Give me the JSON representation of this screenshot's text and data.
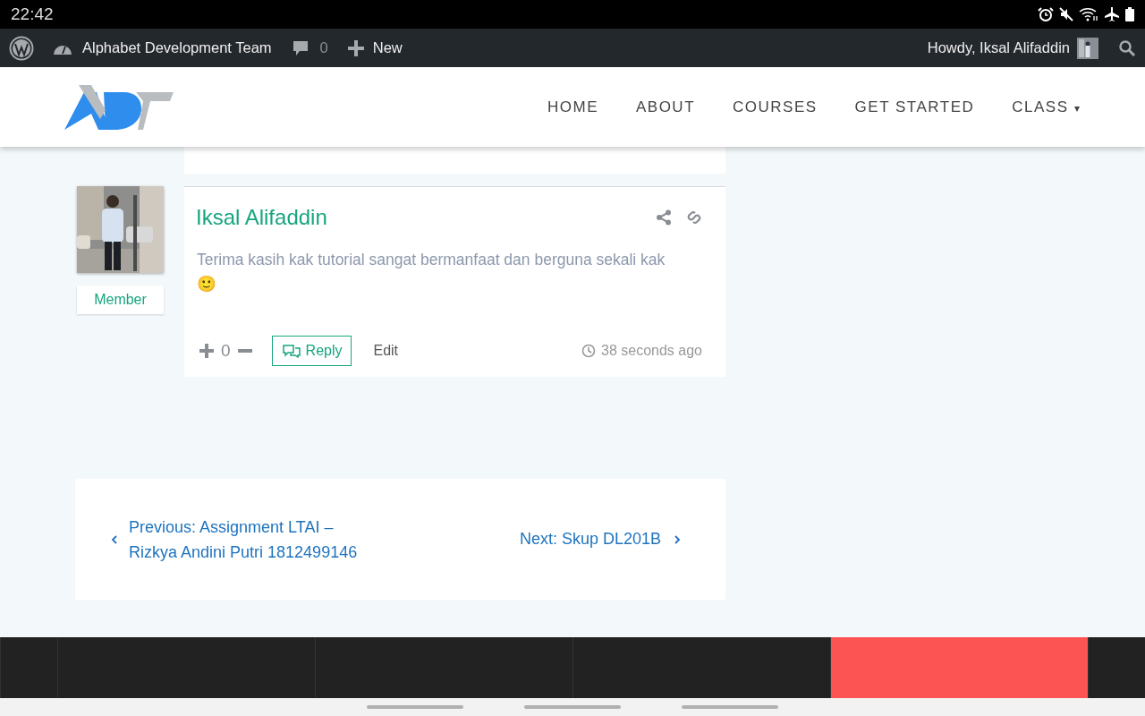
{
  "status_bar": {
    "time": "22:42"
  },
  "admin_bar": {
    "site": "Alphabet Development Team",
    "comments": "0",
    "new": "New",
    "howdy": "Howdy, Iksal Alifaddin"
  },
  "nav": [
    {
      "label": "HOME",
      "dropdown": false
    },
    {
      "label": "ABOUT",
      "dropdown": false
    },
    {
      "label": "COURSES",
      "dropdown": false
    },
    {
      "label": "GET STARTED",
      "dropdown": false
    },
    {
      "label": "CLASS",
      "dropdown": true,
      "caret": "▾"
    }
  ],
  "comment": {
    "author": "Iksal Alifaddin",
    "role": "Member",
    "text": "Terima kasih kak tutorial sangat bermanfaat dan berguna sekali kak",
    "emoji": "🙂",
    "votes": "0",
    "reply": "Reply",
    "edit": "Edit",
    "time": "38 seconds ago"
  },
  "post_nav": {
    "previous": "Previous: Assignment LTAI – Rizkya Andini Putri 1812499146",
    "next": "Next: Skup DL201B"
  },
  "footer_columns": [
    {
      "color": "#222222"
    },
    {
      "color": "#222222"
    },
    {
      "color": "#222222"
    },
    {
      "color": "#222222"
    },
    {
      "color": "#fc5353"
    },
    {
      "color": "#222222"
    }
  ]
}
